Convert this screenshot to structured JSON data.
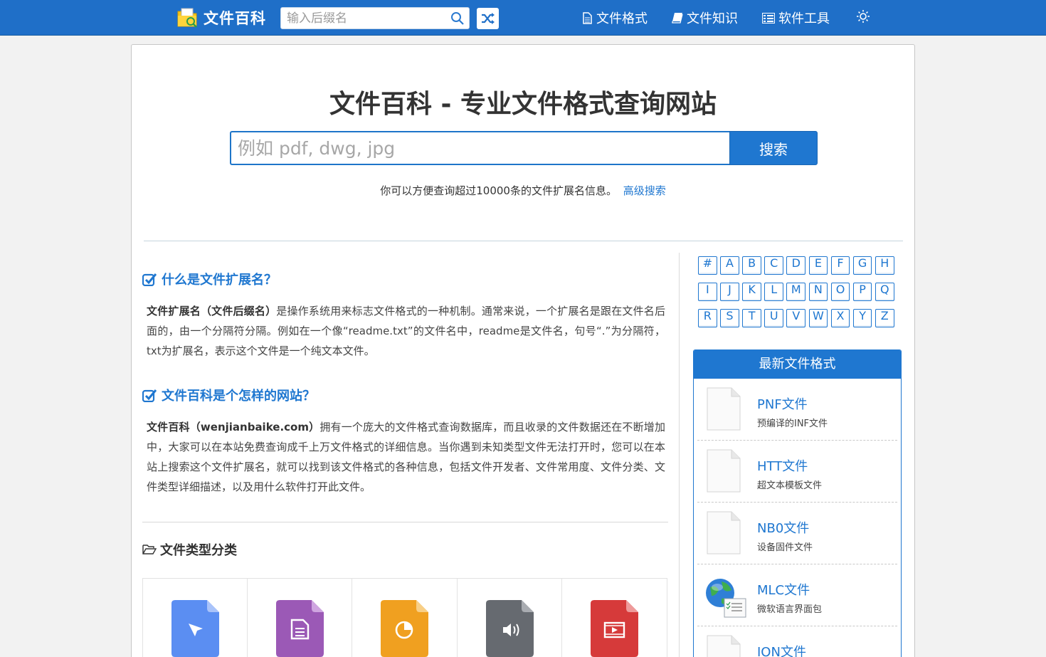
{
  "navbar": {
    "brand": "文件百科",
    "search_placeholder": "输入后缀名",
    "links": [
      {
        "label": "文件格式",
        "icon": "document-icon"
      },
      {
        "label": "文件知识",
        "icon": "book-icon"
      },
      {
        "label": "软件工具",
        "icon": "list-icon"
      }
    ],
    "theme_icon": "sun-icon",
    "random_icon": "shuffle-icon"
  },
  "hero": {
    "title": "文件百科 - 专业文件格式查询网站",
    "search_placeholder": "例如 pdf, dwg, jpg",
    "search_button": "搜索",
    "subtitle": "你可以方便查询超过10000条的文件扩展名信息。",
    "advanced_link": "高级搜索"
  },
  "about": {
    "q1_heading": "什么是文件扩展名？",
    "q1_bold": "文件扩展名（文件后缀名）",
    "q1_text": "是操作系统用来标志文件格式的一种机制。通常来说，一个扩展名是跟在文件名后面的，由一个分隔符分隔。例如在一个像“readme.txt”的文件名中，readme是文件名，句号“.”为分隔符，txt为扩展名，表示这个文件是一个纯文本文件。",
    "q2_heading": "文件百科是个怎样的网站？",
    "q2_bold": "文件百科（wenjianbaike.com）",
    "q2_text": "拥有一个庞大的文件格式查询数据库，而且收录的文件数据还在不断增加中，大家可以在本站免费查询成千上万文件格式的详细信息。当你遇到未知类型文件无法打开时，您可以在本站上搜索这个文件扩展名，就可以找到该文件格式的各种信息，包括文件开发者、文件常用度、文件分类、文件类型详细描述，以及用什么软件打开此文件。"
  },
  "categories": {
    "heading": "文件类型分类",
    "items": [
      {
        "icon": "vector-file-icon",
        "color": "#5b8ef2"
      },
      {
        "icon": "text-file-icon",
        "color": "#9b59b6"
      },
      {
        "icon": "presentation-file-icon",
        "color": "#f0a020"
      },
      {
        "icon": "audio-file-icon",
        "color": "#666a70"
      },
      {
        "icon": "video-file-icon",
        "color": "#d63a3a"
      }
    ]
  },
  "alphabet": [
    [
      "#",
      "A",
      "B",
      "C",
      "D",
      "E",
      "F",
      "G",
      "H"
    ],
    [
      "I",
      "J",
      "K",
      "L",
      "M",
      "N",
      "O",
      "P",
      "Q"
    ],
    [
      "R",
      "S",
      "T",
      "U",
      "V",
      "W",
      "X",
      "Y",
      "Z"
    ]
  ],
  "latest": {
    "heading": "最新文件格式",
    "items": [
      {
        "name": "PNF文件",
        "desc": "预编译的INF文件",
        "icon": "blank-file-icon"
      },
      {
        "name": "HTT文件",
        "desc": "超文本模板文件",
        "icon": "blank-file-icon"
      },
      {
        "name": "NB0文件",
        "desc": "设备固件文件",
        "icon": "blank-file-icon"
      },
      {
        "name": "MLC文件",
        "desc": "微软语言界面包",
        "icon": "globe-file-icon"
      },
      {
        "name": "ION文件",
        "desc": "",
        "icon": "blank-file-icon"
      }
    ]
  },
  "colors": {
    "primary": "#1f77d0",
    "navbar": "#1f6fc8"
  }
}
